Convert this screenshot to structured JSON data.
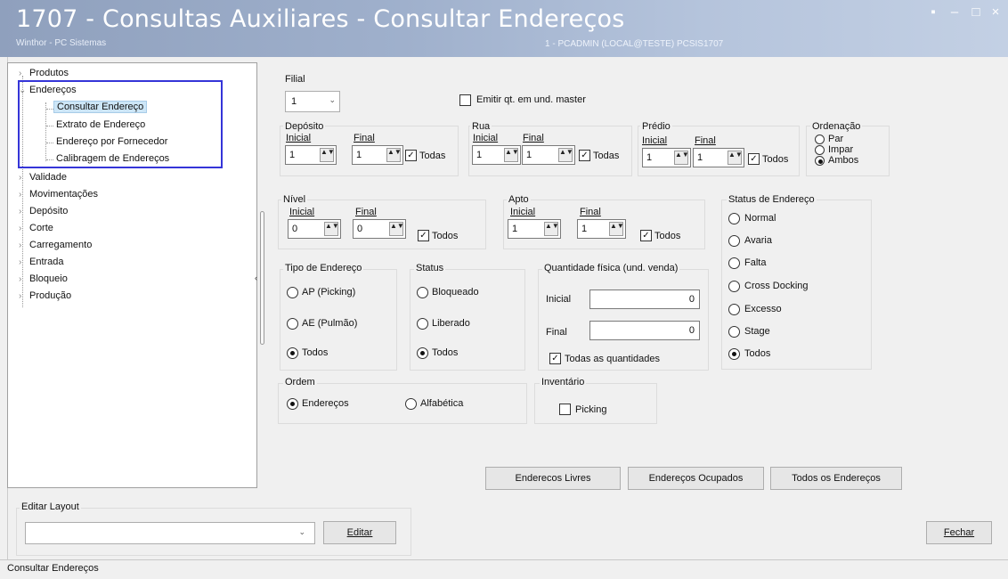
{
  "window": {
    "title": "1707 - Consultas Auxiliares - Consultar Endereços",
    "subtitle": "Winthor - PC Sistemas",
    "session": "1 - PCADMIN (LOCAL@TESTE)   PCSIS1707",
    "controls": [
      "▪",
      "‒",
      "□",
      "×"
    ]
  },
  "tree": {
    "items": [
      {
        "label": "Produtos",
        "expander": "›"
      },
      {
        "label": "Endereços",
        "expander": "⌄"
      },
      {
        "label": "Consultar Endereço"
      },
      {
        "label": "Extrato de Endereço"
      },
      {
        "label": "Endereço por Fornecedor"
      },
      {
        "label": "Calibragem de Endereços"
      },
      {
        "label": "Validade",
        "expander": "›"
      },
      {
        "label": "Movimentações",
        "expander": "›"
      },
      {
        "label": "Depósito",
        "expander": "›"
      },
      {
        "label": "Corte",
        "expander": "›"
      },
      {
        "label": "Carregamento",
        "expander": "›"
      },
      {
        "label": "Entrada",
        "expander": "›"
      },
      {
        "label": "Bloqueio",
        "expander": "›"
      },
      {
        "label": "Produção",
        "expander": "›"
      }
    ]
  },
  "form": {
    "filial": {
      "label": "Filial",
      "value": "1"
    },
    "emitir_master": "Emitir qt. em und. master",
    "deposito": {
      "title": "Depósito",
      "inicial": "Inicial",
      "final": "Final",
      "v_ini": "1",
      "v_fim": "1",
      "todas": "Todas"
    },
    "rua": {
      "title": "Rua",
      "inicial": "Inicial",
      "final": "Final",
      "v_ini": "1",
      "v_fim": "1",
      "todas": "Todas"
    },
    "predio": {
      "title": "Prédio",
      "inicial": "Inicial",
      "final": "Final",
      "v_ini": "1",
      "v_fim": "1",
      "todos": "Todos"
    },
    "ordenacao": {
      "title": "Ordenação",
      "options": [
        "Par",
        "Impar",
        "Ambos"
      ]
    },
    "nivel": {
      "title": "Nível",
      "inicial": "Inicial",
      "final": "Final",
      "v_ini": "0",
      "v_fim": "0",
      "todos": "Todos"
    },
    "apto": {
      "title": "Apto",
      "inicial": "Inicial",
      "final": "Final",
      "v_ini": "1",
      "v_fim": "1",
      "todos": "Todos"
    },
    "status_endereco": {
      "title": "Status de Endereço",
      "options": [
        "Normal",
        "Avaria",
        "Falta",
        "Cross Docking",
        "Excesso",
        "Stage",
        "Todos"
      ]
    },
    "tipo_endereco": {
      "title": "Tipo de Endereço",
      "options": [
        "AP (Picking)",
        "AE (Pulmão)",
        "Todos"
      ]
    },
    "status": {
      "title": "Status",
      "options": [
        "Bloqueado",
        "Liberado",
        "Todos"
      ]
    },
    "quantidade": {
      "title": "Quantidade física (und. venda)",
      "inicial": "Inicial",
      "final": "Final",
      "v_ini": "0",
      "v_fim": "0",
      "todas": "Todas as quantidades"
    },
    "ordem": {
      "title": "Ordem",
      "options": [
        "Endereços",
        "Alfabética"
      ]
    },
    "inventario": {
      "title": "Inventário",
      "picking": "Picking"
    }
  },
  "buttons": {
    "livres": "Enderecos Livres",
    "ocupados": "Endereços Ocupados",
    "todos": "Todos os Endereços",
    "editar": "Editar",
    "fechar": "Fechar"
  },
  "layout_section": {
    "title": "Editar Layout",
    "value": ""
  },
  "statusbar": {
    "text": "Consultar Endereços"
  },
  "icons": {
    "check": "✓",
    "spin": "▲▼",
    "dropdown": "⌄",
    "collapse": "‹"
  },
  "colors": {
    "titlebar": "#9fb0cc",
    "highlight": "#3535d8",
    "selection": "#cde6f7"
  }
}
